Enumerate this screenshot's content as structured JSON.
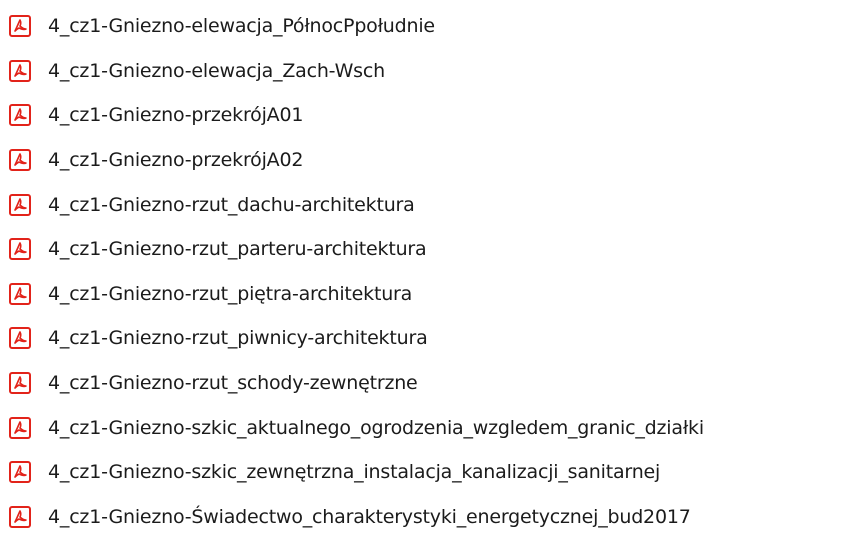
{
  "files": [
    {
      "name": "4_cz1-Gniezno-elewacja_PółnocPpołudnie",
      "icon": "pdf-file-icon"
    },
    {
      "name": "4_cz1-Gniezno-elewacja_Zach-Wsch",
      "icon": "pdf-file-icon"
    },
    {
      "name": "4_cz1-Gniezno-przekrójA01",
      "icon": "pdf-file-icon"
    },
    {
      "name": "4_cz1-Gniezno-przekrójA02",
      "icon": "pdf-file-icon"
    },
    {
      "name": "4_cz1-Gniezno-rzut_dachu-architektura",
      "icon": "pdf-file-icon"
    },
    {
      "name": "4_cz1-Gniezno-rzut_parteru-architektura",
      "icon": "pdf-file-icon"
    },
    {
      "name": "4_cz1-Gniezno-rzut_piętra-architektura",
      "icon": "pdf-file-icon"
    },
    {
      "name": "4_cz1-Gniezno-rzut_piwnicy-architektura",
      "icon": "pdf-file-icon"
    },
    {
      "name": "4_cz1-Gniezno-rzut_schody-zewnętrzne",
      "icon": "pdf-file-icon"
    },
    {
      "name": "4_cz1-Gniezno-szkic_aktualnego_ogrodzenia_wzgledem_granic_działki",
      "icon": "pdf-file-icon"
    },
    {
      "name": "4_cz1-Gniezno-szkic_zewnętrzna_instalacja_kanalizacji_sanitarnej",
      "icon": "pdf-file-icon"
    },
    {
      "name": "4_cz1-Gniezno-Świadectwo_charakterystyki_energetycznej_bud2017",
      "icon": "pdf-file-icon"
    }
  ],
  "colors": {
    "pdf_icon_red": "#e2231a",
    "text": "#1b1b1b",
    "background": "#ffffff"
  }
}
